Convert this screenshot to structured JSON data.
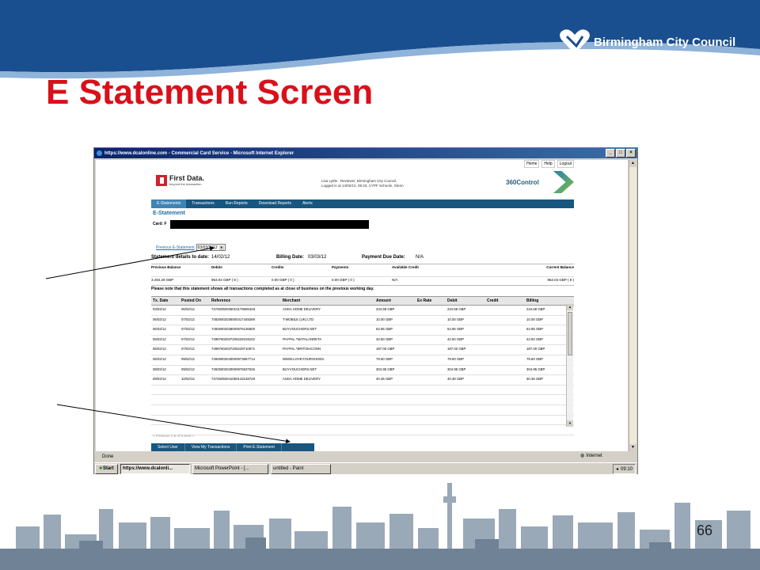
{
  "slide": {
    "title": "E Statement Screen",
    "org_name": "Birmingham City Council",
    "page_number": "66",
    "colors": {
      "title": "#d9101a",
      "header_band": "#1a4f8f"
    }
  },
  "browser": {
    "window_title": "https://www.dcalonline.com - Commercial Card Service - Microsoft Internet Explorer",
    "status_text": "Done",
    "zone_text": "Internet"
  },
  "taskbar": {
    "start_label": "Start",
    "tasks": [
      "https://www.dcalonli...",
      "Microsoft PowerPoint - [...",
      "untitled - Paint"
    ],
    "clock": "09:10"
  },
  "site": {
    "top_links": [
      "Home",
      "Help",
      "Logout"
    ],
    "logo_name": "First Data.",
    "logo_tagline": "beyond the transaction",
    "user_line1": "Lisa Lyttle : Reviewer, Birmingham City Council.",
    "user_line2": "Logged in at 14/02/12, 08:43, CYPF Schools, Glenn",
    "product_name": "360Control",
    "nav": [
      "E-Statements",
      "Transactions",
      "Run Reports",
      "Download Reports",
      "Alerts"
    ],
    "nav_color": "#17567f"
  },
  "statement": {
    "heading": "E-Statement",
    "card_label": "Card: F",
    "previous_link": "Previous E-Statement",
    "previous_select": "03/03/2012",
    "details_to_date_label": "Statement details to date:",
    "details_to_date": "14/02/12",
    "billing_date_label": "Billing Date:",
    "billing_date": "03/03/12",
    "due_date_label": "Payment Due Date:",
    "due_date": "N/A",
    "balance_labels": [
      "Previous Balance",
      "Debits",
      "Credits",
      "Payments",
      "Available Credit",
      "Current Balance"
    ],
    "balance_values": [
      "3,494.29 GBP",
      "963.04 GBP ( 8 )",
      "0.00 GBP ( 0 )",
      "0.00 GBP ( 0 )",
      "N/A",
      "963.04 GBP ( 8 )"
    ],
    "notice": "Please note that this statement shows all transactions completed as at close of business on the previous working day.",
    "columns": [
      "Tx. Date",
      "Posted On",
      "Reference",
      "Merchant",
      "Amount",
      "Ex Rate",
      "Debit",
      "Credit",
      "Billing"
    ],
    "rows": [
      [
        "03/02/12",
        "06/02/12",
        "74745092035010179606348",
        "ASDA HOME DELIVERY",
        "234.58 GBP",
        "",
        "234.58 GBP",
        "",
        "234.58 GBP"
      ],
      [
        "06/02/12",
        "07/02/12",
        "74929002036000417449289",
        "T-MOBILE (UK) LTD",
        "10.00 GBP",
        "",
        "10.00 GBP",
        "",
        "10.00 GBP"
      ],
      [
        "06/02/12",
        "07/02/12",
        "74929002038000676136600",
        "BUYVOUCHERS.NET",
        "64.95 GBP",
        "",
        "64.95 GBP",
        "",
        "64.95 GBP"
      ],
      [
        "06/02/12",
        "07/02/12",
        "74997602037205229419102",
        "PAYPAL *MATALANRETA",
        "42.50 GBP",
        "",
        "42.50 GBP",
        "",
        "42.50 GBP"
      ],
      [
        "06/02/12",
        "07/02/12",
        "74997602037205229710971",
        "PAYPAL *BRITISHCONN",
        "187.00 GBP",
        "",
        "187.00 GBP",
        "",
        "187.00 GBP"
      ],
      [
        "06/02/12",
        "09/02/12",
        "74929002040000973667714",
        "WWW.LOVEYOURSHOES.",
        "79.50 GBP",
        "",
        "79.50 GBP",
        "",
        "79.50 GBP"
      ],
      [
        "08/02/12",
        "09/02/12",
        "74929002040000976637526",
        "BUYVOUCHERS.NET",
        "304.95 GBP",
        "",
        "304.95 GBP",
        "",
        "304.95 GBP"
      ],
      [
        "09/02/12",
        "10/02/12",
        "74745092041050143148748",
        "ASDA HOME DELIVERY",
        "40.36 GBP",
        "",
        "40.36 GBP",
        "",
        "40.36 GBP"
      ]
    ],
    "pager": "< Previous 1-8 of 8 Next >",
    "actions": [
      "Select User",
      "View My Transactions",
      "Print E-Statement"
    ]
  }
}
